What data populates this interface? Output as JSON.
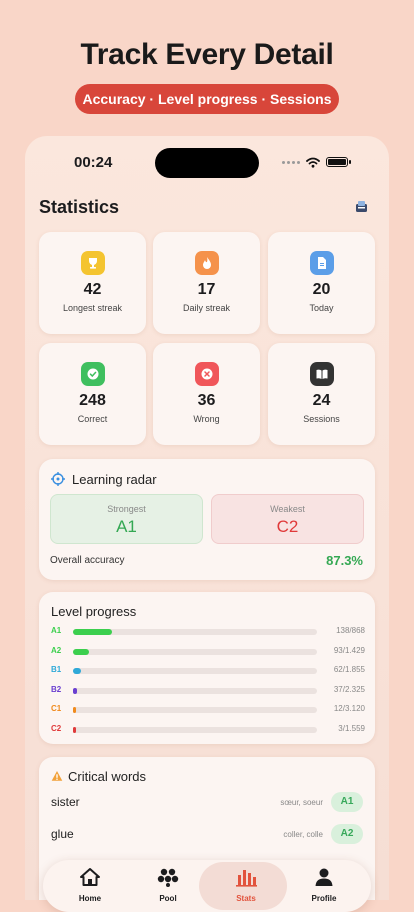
{
  "headline": "Track Every Detail",
  "subtitle": "Accuracy · Level progress · Sessions",
  "status": {
    "time": "00:24"
  },
  "screen_title": "Statistics",
  "stats": [
    {
      "value": "42",
      "label": "Longest streak",
      "icon": "trophy-icon",
      "color": "#f4c430"
    },
    {
      "value": "17",
      "label": "Daily streak",
      "icon": "flame-icon",
      "color": "#f5924b"
    },
    {
      "value": "20",
      "label": "Today",
      "icon": "document-icon",
      "color": "#5b9ee8"
    },
    {
      "value": "248",
      "label": "Correct",
      "icon": "checkmark-icon",
      "color": "#3fbf5f"
    },
    {
      "value": "36",
      "label": "Wrong",
      "icon": "x-icon",
      "color": "#f0565a"
    },
    {
      "value": "24",
      "label": "Sessions",
      "icon": "book-icon",
      "color": "#333333"
    }
  ],
  "radar": {
    "title": "Learning radar",
    "strongest_label": "Strongest",
    "strongest_value": "A1",
    "weakest_label": "Weakest",
    "weakest_value": "C2",
    "accuracy_label": "Overall accuracy",
    "accuracy_value": "87.3%"
  },
  "level_progress": {
    "title": "Level progress",
    "levels": [
      {
        "code": "A1",
        "count": "138/868",
        "fraction": 0.159,
        "color": "#3ccf4e"
      },
      {
        "code": "A2",
        "count": "93/1.429",
        "fraction": 0.065,
        "color": "#3ccf4e"
      },
      {
        "code": "B1",
        "count": "62/1.855",
        "fraction": 0.033,
        "color": "#2fa9d8"
      },
      {
        "code": "B2",
        "count": "37/2.325",
        "fraction": 0.016,
        "color": "#6a3fd0"
      },
      {
        "code": "C1",
        "count": "12/3.120",
        "fraction": 0.004,
        "color": "#f08a1c"
      },
      {
        "code": "C2",
        "count": "3/1.559",
        "fraction": 0.002,
        "color": "#e03a3a"
      }
    ]
  },
  "critical_words": {
    "title": "Critical words",
    "items": [
      {
        "word": "sister",
        "translation": "sœur, soeur",
        "level": "A1"
      },
      {
        "word": "glue",
        "translation": "coller, colle",
        "level": "A2"
      }
    ]
  },
  "tabs": [
    {
      "label": "Home",
      "icon": "house-icon",
      "active": false
    },
    {
      "label": "Pool",
      "icon": "pool-icon",
      "active": false
    },
    {
      "label": "Stats",
      "icon": "bar-chart-icon",
      "active": true
    },
    {
      "label": "Profile",
      "icon": "person-icon",
      "active": false
    }
  ]
}
